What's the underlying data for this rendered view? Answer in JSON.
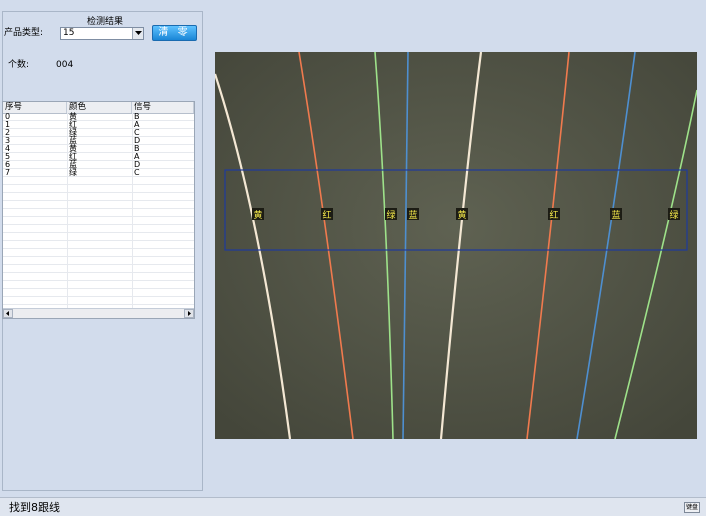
{
  "panel": {
    "title": "检测结果",
    "product_type_label": "产品类型:",
    "product_type_value": "15",
    "clear_button": "清 零",
    "count_label": "个数:",
    "count_value": "004"
  },
  "table": {
    "columns": [
      "序号",
      "颜色",
      "信号"
    ],
    "rows": [
      {
        "idx": "0",
        "color": "黄",
        "signal": "B"
      },
      {
        "idx": "1",
        "color": "红",
        "signal": "A"
      },
      {
        "idx": "2",
        "color": "绿",
        "signal": "C"
      },
      {
        "idx": "3",
        "color": "蓝",
        "signal": "D"
      },
      {
        "idx": "4",
        "color": "黄",
        "signal": "B"
      },
      {
        "idx": "5",
        "color": "红",
        "signal": "A"
      },
      {
        "idx": "6",
        "color": "蓝",
        "signal": "D"
      },
      {
        "idx": "7",
        "color": "绿",
        "signal": "C"
      }
    ]
  },
  "viewer": {
    "wires": [
      {
        "label": "黄",
        "color": "#f4e8d4"
      },
      {
        "label": "红",
        "color": "#f07a4e"
      },
      {
        "label": "绿",
        "color": "#9ee28a"
      },
      {
        "label": "蓝",
        "color": "#4e8fd0"
      },
      {
        "label": "黄",
        "color": "#f4e8d4"
      },
      {
        "label": "红",
        "color": "#f07a4e"
      },
      {
        "label": "蓝",
        "color": "#4e8fd0"
      },
      {
        "label": "绿",
        "color": "#9ee28a"
      }
    ],
    "roi_color": "#1e3a9c",
    "tag_text_color": "#f5e94a"
  },
  "status": {
    "message": "找到8跟线",
    "keyboard_button": "键盘"
  }
}
